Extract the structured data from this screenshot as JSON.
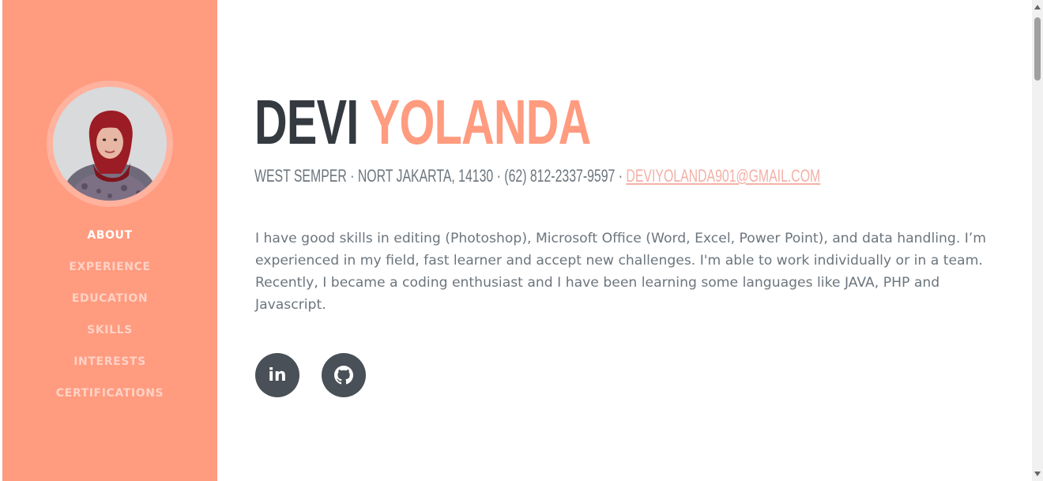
{
  "sidebar": {
    "nav": [
      {
        "label": "ABOUT",
        "active": true
      },
      {
        "label": "EXPERIENCE",
        "active": false
      },
      {
        "label": "EDUCATION",
        "active": false
      },
      {
        "label": "SKILLS",
        "active": false
      },
      {
        "label": "INTERESTS",
        "active": false
      },
      {
        "label": "CERTIFICATIONS",
        "active": false
      }
    ]
  },
  "header": {
    "first_name": "DEVI",
    "last_name": "YOLANDA",
    "address": "WEST SEMPER · NORT JAKARTA, 14130 · (62) 812-2337-9597 · ",
    "email": "DEVIYOLANDA901@GMAIL.COM"
  },
  "about": {
    "text": "I have good skills in editing (Photoshop), Microsoft Office (Word, Excel, Power Point), and data handling. I’m experienced in my field, fast learner and accept new challenges. I'm able to work individually or in a team. Recently, I became a coding enthusiast and I have been learning some languages like JAVA, PHP and Javascript."
  },
  "social": {
    "linkedin_label": "in",
    "linkedin_icon": "linkedin-icon",
    "github_icon": "github-icon"
  },
  "colors": {
    "primary": "#ff9b7f",
    "dark": "#343a40",
    "muted": "#6c757d",
    "social_bg": "#495057"
  }
}
